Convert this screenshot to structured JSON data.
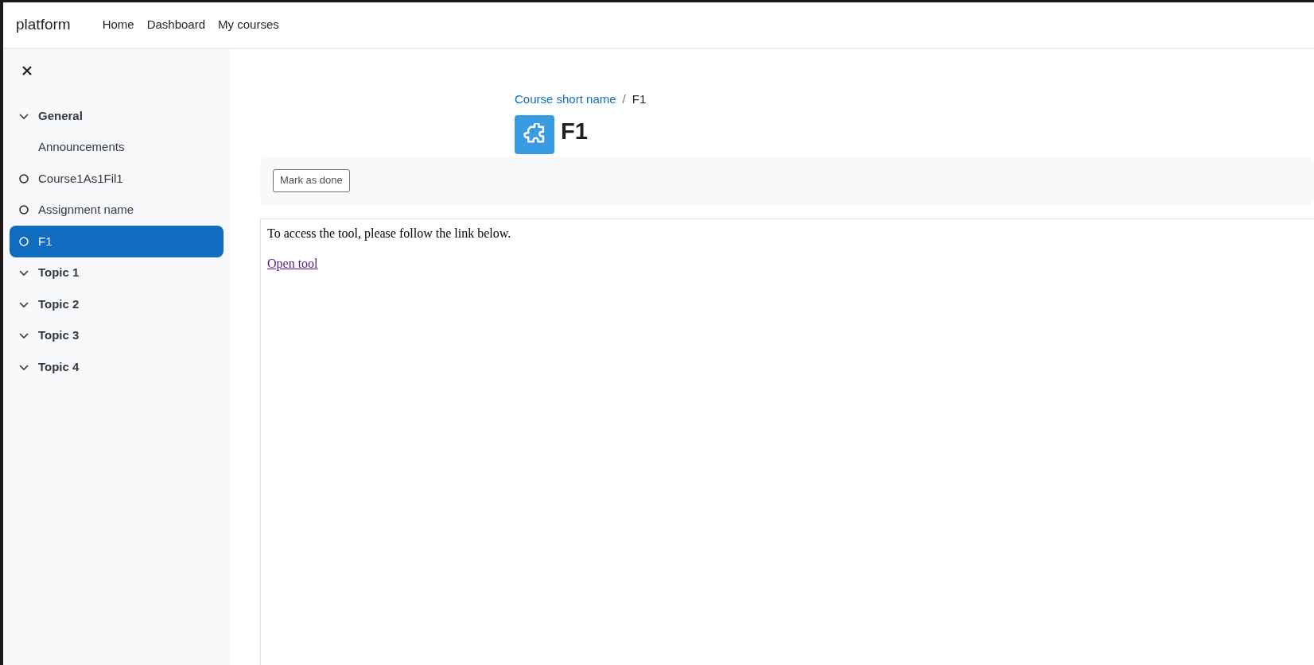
{
  "navbar": {
    "brand": "platform",
    "links": [
      {
        "label": "Home"
      },
      {
        "label": "Dashboard"
      },
      {
        "label": "My courses"
      }
    ]
  },
  "sidebar": {
    "items": [
      {
        "kind": "section",
        "label": "General",
        "expanded": true,
        "selected": false
      },
      {
        "kind": "page",
        "label": "Announcements",
        "selected": false
      },
      {
        "kind": "activity",
        "label": "Course1As1Fil1",
        "selected": false
      },
      {
        "kind": "activity",
        "label": "Assignment name",
        "selected": false
      },
      {
        "kind": "activity",
        "label": "F1",
        "selected": true
      },
      {
        "kind": "section",
        "label": "Topic 1",
        "expanded": true,
        "selected": false
      },
      {
        "kind": "section",
        "label": "Topic 2",
        "expanded": true,
        "selected": false
      },
      {
        "kind": "section",
        "label": "Topic 3",
        "expanded": true,
        "selected": false
      },
      {
        "kind": "section",
        "label": "Topic 4",
        "expanded": true,
        "selected": false
      }
    ]
  },
  "breadcrumb": [
    {
      "label": "Course short name",
      "link": true
    },
    {
      "label": "/",
      "kind": "separator"
    },
    {
      "label": "F1",
      "link": false
    }
  ],
  "page_title": "F1",
  "completion": {
    "button": "Mark as done"
  },
  "content": {
    "text": "To access the tool, please follow the link below.",
    "link": "Open tool"
  }
}
